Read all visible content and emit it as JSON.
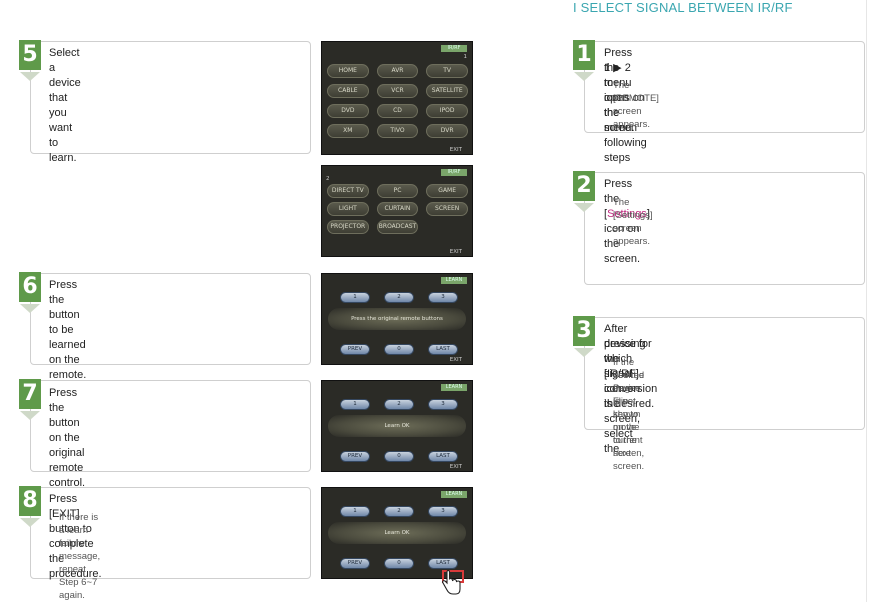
{
  "section_title": "I SELECT SIGNAL BETWEEN IR/RF",
  "left_steps": [
    {
      "num": "5",
      "title": "Select a device that you want to learn.",
      "sub": ""
    },
    {
      "num": "6",
      "title": "Press the button to be learned on the remote.",
      "sub": ""
    },
    {
      "num": "7",
      "title": "Press the button on the original remote control.",
      "sub": ""
    },
    {
      "num": "8",
      "title": "Press [EXIT] button to complete the procedure.",
      "sub": "If there is a learn failure message, repeat Step 6~7 again."
    }
  ],
  "right_steps": [
    {
      "num": "1",
      "title_a": "Press the menu icons on the screen following steps",
      "title_b": "1 ▶ 2 to open the menu.",
      "sub": "The [REMOTE] screen appears."
    },
    {
      "num": "2",
      "title_pre": "Press the [",
      "title_hl": "Settings",
      "title_post": "] icon on the screen.",
      "sub": "The [Settings] screen appears.",
      "highlight_color": "#c0287f"
    },
    {
      "num": "3",
      "title_a": "After pressing the [IR/RF] icon on the screen, select the",
      "title_b": "device for which signal conversion is desired.",
      "sub_a": "If the desired device is not shown on the current screen,",
      "sub_b": "use the Page Flip key to move to the next screen."
    }
  ],
  "screens": {
    "device_menu_1": {
      "badge": "IR/RF",
      "page": "1",
      "buttons": [
        "HOME",
        "AVR",
        "TV",
        "CABLE",
        "VCR",
        "SATELLITE",
        "DVD",
        "CD",
        "IPOD",
        "XM",
        "TIVO",
        "DVR"
      ],
      "exit": "EXIT"
    },
    "device_menu_2": {
      "badge": "IR/RF",
      "page": "2",
      "buttons": [
        "DIRECT TV",
        "PC",
        "GAME",
        "LIGHT",
        "CURTAIN",
        "SCREEN",
        "PROJECTOR",
        "BROADCAST"
      ],
      "exit": "EXIT"
    },
    "learn_6": {
      "badge": "LEARN",
      "buttons": [
        "1",
        "2",
        "3",
        "PREV",
        "0",
        "LAST"
      ],
      "message": "Press the original remote buttons",
      "exit": "EXIT"
    },
    "learn_7": {
      "badge": "LEARN",
      "buttons": [
        "1",
        "2",
        "3",
        "PREV",
        "0",
        "LAST"
      ],
      "message": "Learn OK",
      "exit": "EXIT"
    },
    "learn_8": {
      "badge": "LEARN",
      "buttons": [
        "1",
        "2",
        "3",
        "PREV",
        "0",
        "LAST"
      ],
      "message": "Learn OK",
      "exit": "EXIT"
    }
  },
  "colors": {
    "accent_green": "#5f9a4a",
    "title_teal": "#3aa6b0",
    "highlight_magenta": "#c0287f",
    "exit_highlight_red": "#d83a3a"
  }
}
